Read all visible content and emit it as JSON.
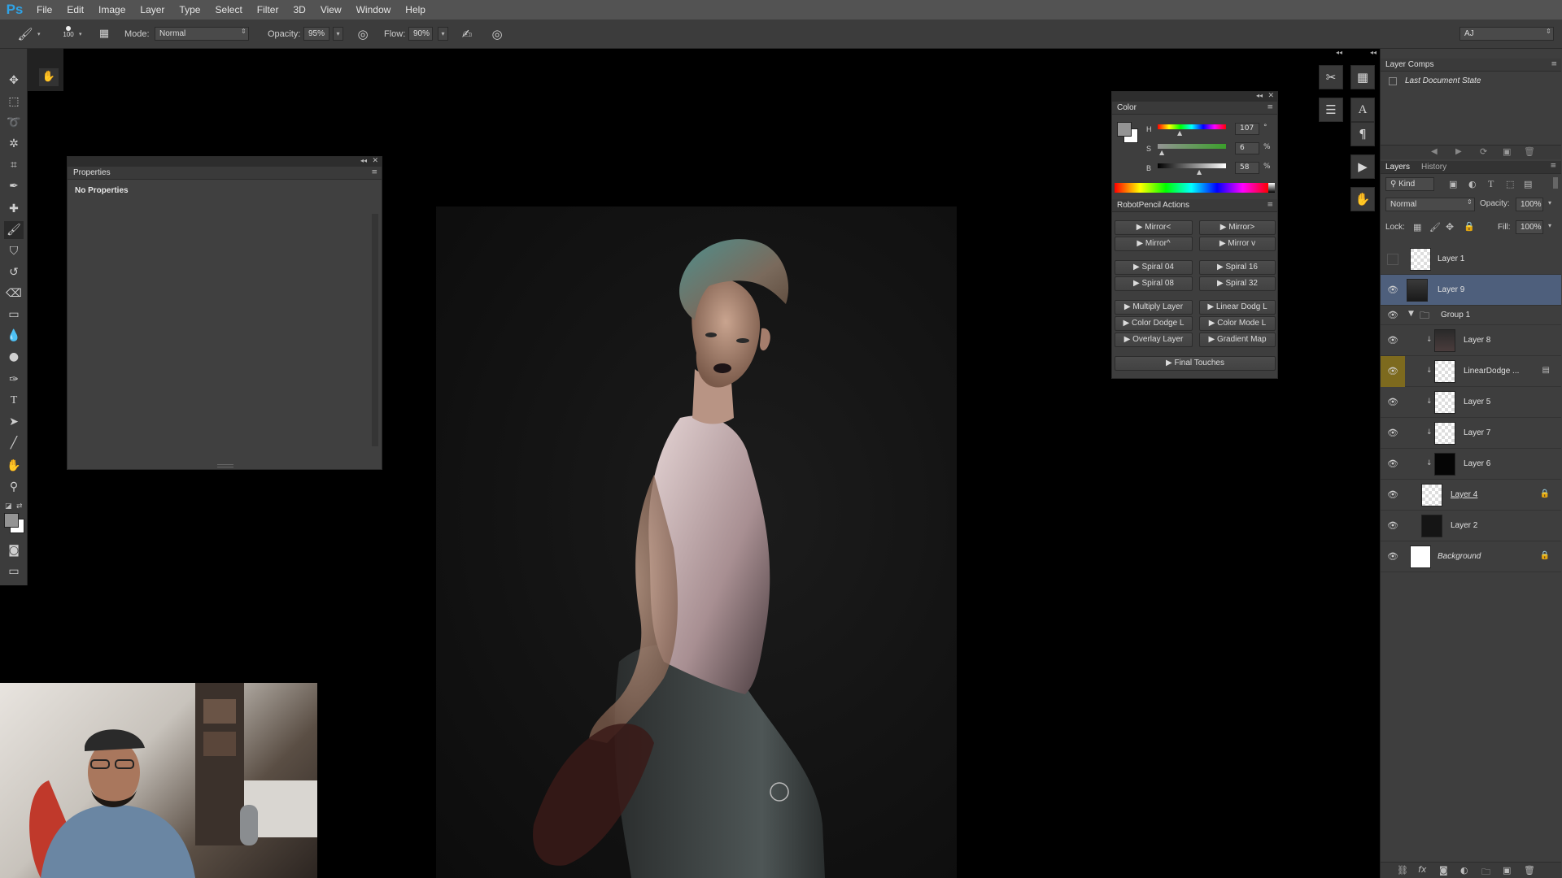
{
  "app": {
    "logo": "Ps"
  },
  "menu": [
    "File",
    "Edit",
    "Image",
    "Layer",
    "Type",
    "Select",
    "Filter",
    "3D",
    "View",
    "Window",
    "Help"
  ],
  "options_bar": {
    "brush_size": "100",
    "mode_label": "Mode:",
    "mode_value": "Normal",
    "opacity_label": "Opacity:",
    "opacity_value": "95%",
    "flow_label": "Flow:",
    "flow_value": "90%",
    "workspace": "AJ"
  },
  "properties_panel": {
    "tab": "Properties",
    "message": "No Properties"
  },
  "color_panel": {
    "tab": "Color",
    "h_label": "H",
    "h_value": "107",
    "h_unit": "°",
    "s_label": "S",
    "s_value": "6",
    "s_unit": "%",
    "b_label": "B",
    "b_value": "58",
    "b_unit": "%",
    "foreground_color": "#949494",
    "background_color": "#ffffff"
  },
  "actions_panel": {
    "tab": "RobotPencil Actions",
    "buttons": [
      "Mirror<",
      "Mirror>",
      "Mirror^",
      "Mirror v",
      "Spiral 04",
      "Spiral 16",
      "Spiral 08",
      "Spiral 32",
      "Multiply Layer",
      "Linear Dodg L",
      "Color Dodge L",
      "Color Mode L",
      "Overlay Layer",
      "Gradient Map",
      "Final Touches"
    ]
  },
  "layer_comps": {
    "tab": "Layer Comps",
    "item": "Last Document State"
  },
  "layers_panel": {
    "tabs": [
      "Layers",
      "History"
    ],
    "kind_label": "Kind",
    "blend_mode": "Normal",
    "opacity_label": "Opacity:",
    "opacity_value": "100%",
    "lock_label": "Lock:",
    "fill_label": "Fill:",
    "fill_value": "100%",
    "layers": [
      {
        "name": "Layer 1",
        "visible": false,
        "selected": false
      },
      {
        "name": "Layer 9",
        "visible": true,
        "selected": true
      },
      {
        "name": "Group 1",
        "visible": true,
        "selected": false
      },
      {
        "name": "Layer 8",
        "visible": true,
        "selected": false
      },
      {
        "name": "LinearDodge ...",
        "visible": true,
        "selected": false
      },
      {
        "name": "Layer 5",
        "visible": true,
        "selected": false
      },
      {
        "name": "Layer 7",
        "visible": true,
        "selected": false
      },
      {
        "name": "Layer 6",
        "visible": true,
        "selected": false
      },
      {
        "name": "Layer 4",
        "visible": true,
        "selected": false
      },
      {
        "name": "Layer 2",
        "visible": true,
        "selected": false
      },
      {
        "name": "Background",
        "visible": true,
        "selected": false
      }
    ]
  },
  "colors": {
    "selected_layer": "#4e5f7c",
    "ps_blue": "#2fa3e6",
    "hair": "#4f8f8c"
  }
}
